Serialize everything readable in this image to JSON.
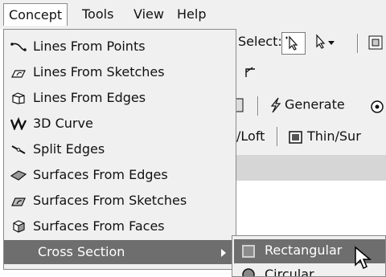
{
  "menubar": {
    "items": [
      {
        "label": "Concept"
      },
      {
        "label": "Tools"
      },
      {
        "label": "View"
      },
      {
        "label": "Help"
      }
    ]
  },
  "toolbar": {
    "select_label": "Select:",
    "generate_label": "Generate",
    "loft_label": "/Loft",
    "thin_label": "Thin/Sur"
  },
  "dropdown": {
    "items": [
      {
        "label": "Lines From Points",
        "icon": "line-points-icon"
      },
      {
        "label": "Lines From Sketches",
        "icon": "line-sketch-icon"
      },
      {
        "label": "Lines From Edges",
        "icon": "line-edges-icon"
      },
      {
        "label": "3D Curve",
        "icon": "curve-3d-icon"
      },
      {
        "label": "Split Edges",
        "icon": "split-edges-icon"
      },
      {
        "label": "Surfaces From Edges",
        "icon": "surface-edges-icon"
      },
      {
        "label": "Surfaces From Sketches",
        "icon": "surface-sketch-icon"
      },
      {
        "label": "Surfaces From Faces",
        "icon": "surface-faces-icon"
      },
      {
        "label": "Cross Section",
        "icon": "submenu-arrow-icon"
      }
    ]
  },
  "submenu": {
    "items": [
      {
        "label": "Rectangular"
      },
      {
        "label": "Circular"
      }
    ]
  }
}
